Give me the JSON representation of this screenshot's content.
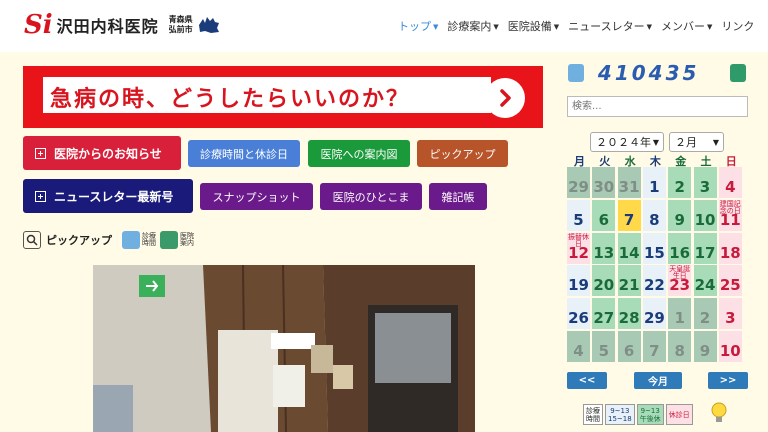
{
  "header": {
    "logo_mark": "Si",
    "logo_name": "沢田内科医院",
    "logo_pref_line1": "青森県",
    "logo_pref_line2": "弘前市",
    "nav": [
      {
        "label": "トップ",
        "has_caret": true,
        "active": true
      },
      {
        "label": "診療案内",
        "has_caret": true,
        "active": false
      },
      {
        "label": "医院設備",
        "has_caret": true,
        "active": false
      },
      {
        "label": "ニュースレター",
        "has_caret": true,
        "active": false
      },
      {
        "label": "メンバー",
        "has_caret": true,
        "active": false
      },
      {
        "label": "リンク",
        "has_caret": false,
        "active": false
      }
    ]
  },
  "banner": {
    "text": "急病の時、どうしたらいいのか？",
    "bg_color": "#e8141a"
  },
  "buttons": {
    "news": "医院からのお知らせ",
    "hours": "診療時間と休診日",
    "guide": "医院への案内図",
    "pickup": "ピックアップ",
    "newsletter": "ニュースレター最新号",
    "snapshot": "スナップショット",
    "hitokoma": "医院のひとこま",
    "zakki": "雑記帳"
  },
  "pickup_row": {
    "label": "ピックアップ",
    "mini1_line1": "診療",
    "mini1_line2": "時間",
    "mini2_line1": "医院",
    "mini2_line2": "案内"
  },
  "sidebar": {
    "counter": "410435",
    "search_placeholder": "検索...",
    "year_select": "２０２４年",
    "month_select": "２月",
    "weekdays": [
      "月",
      "火",
      "水",
      "木",
      "金",
      "土",
      "日"
    ],
    "calendar_weeks": [
      [
        {
          "d": "29",
          "t": "out"
        },
        {
          "d": "30",
          "t": "out"
        },
        {
          "d": "31",
          "t": "out"
        },
        {
          "d": "1",
          "t": "in"
        },
        {
          "d": "2",
          "t": "green"
        },
        {
          "d": "3",
          "t": "sat"
        },
        {
          "d": "4",
          "t": "sun"
        }
      ],
      [
        {
          "d": "5",
          "t": "in"
        },
        {
          "d": "6",
          "t": "green"
        },
        {
          "d": "7",
          "t": "today"
        },
        {
          "d": "8",
          "t": "in"
        },
        {
          "d": "9",
          "t": "green"
        },
        {
          "d": "10",
          "t": "sat"
        },
        {
          "d": "11",
          "t": "hol",
          "note": "建国記念の日"
        }
      ],
      [
        {
          "d": "12",
          "t": "hol",
          "note": "振替休日"
        },
        {
          "d": "13",
          "t": "green"
        },
        {
          "d": "14",
          "t": "green"
        },
        {
          "d": "15",
          "t": "in"
        },
        {
          "d": "16",
          "t": "green"
        },
        {
          "d": "17",
          "t": "sat"
        },
        {
          "d": "18",
          "t": "sun"
        }
      ],
      [
        {
          "d": "19",
          "t": "in"
        },
        {
          "d": "20",
          "t": "green"
        },
        {
          "d": "21",
          "t": "green"
        },
        {
          "d": "22",
          "t": "in"
        },
        {
          "d": "23",
          "t": "hol",
          "note": "天皇誕生日"
        },
        {
          "d": "24",
          "t": "sat"
        },
        {
          "d": "25",
          "t": "sun"
        }
      ],
      [
        {
          "d": "26",
          "t": "in"
        },
        {
          "d": "27",
          "t": "green"
        },
        {
          "d": "28",
          "t": "green"
        },
        {
          "d": "29",
          "t": "in"
        },
        {
          "d": "1",
          "t": "out"
        },
        {
          "d": "2",
          "t": "out"
        },
        {
          "d": "3",
          "t": "sun"
        }
      ],
      [
        {
          "d": "4",
          "t": "out-in"
        },
        {
          "d": "5",
          "t": "out"
        },
        {
          "d": "6",
          "t": "out"
        },
        {
          "d": "7",
          "t": "out-in"
        },
        {
          "d": "8",
          "t": "out"
        },
        {
          "d": "9",
          "t": "out"
        },
        {
          "d": "10",
          "t": "sun"
        }
      ]
    ],
    "prev_label": "<<",
    "today_label": "今月",
    "next_label": ">>",
    "legend": {
      "l1a": "診療",
      "l1b": "時間",
      "l2a": "9~13",
      "l2b": "15~18",
      "l3a": "9~13",
      "l3b": "午後休",
      "l4": "休診日"
    }
  }
}
